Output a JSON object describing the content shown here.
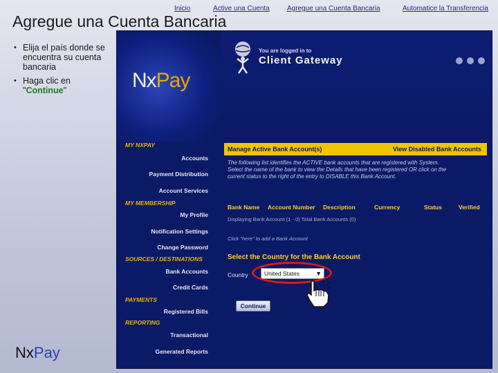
{
  "topnav": {
    "items": [
      {
        "label": "Inicio"
      },
      {
        "label": "Active una Cuenta"
      },
      {
        "label": "Agregue una Cuenta Bancaria"
      },
      {
        "label": "Automatice la Transferencia"
      }
    ]
  },
  "slide": {
    "title": "Agregue una Cuenta Bancaria",
    "bullets": [
      {
        "text": "Elija el país donde se encuentra su cuenta bancaria"
      },
      {
        "text_before": "Haga clic en \"",
        "highlight": "Continue",
        "text_after": "\""
      }
    ],
    "footer_brand": {
      "nx": "Nx",
      "pay": "Pay"
    }
  },
  "app": {
    "logo": {
      "nx": "Nx",
      "pay": "Pay"
    },
    "header": {
      "logged_in": "You are logged in to",
      "gateway": "Client Gateway"
    },
    "leftnav": [
      {
        "type": "section",
        "label": "MY NXPAY"
      },
      {
        "type": "item",
        "label": "Accounts"
      },
      {
        "type": "item",
        "label": "Payment Distribution"
      },
      {
        "type": "item",
        "label": "Account Services"
      },
      {
        "type": "section",
        "label": "MY MEMBERSHIP"
      },
      {
        "type": "item",
        "label": "My Profile"
      },
      {
        "type": "item",
        "label": "Notification Settings"
      },
      {
        "type": "item",
        "label": "Change Password"
      },
      {
        "type": "section",
        "label": "SOURCES / DESTINATIONS"
      },
      {
        "type": "item",
        "label": "Bank Accounts"
      },
      {
        "type": "item",
        "label": "Credit Cards"
      },
      {
        "type": "section",
        "label": "PAYMENTS"
      },
      {
        "type": "item",
        "label": "Registered Bills"
      },
      {
        "type": "section",
        "label": "REPORTING"
      },
      {
        "type": "item",
        "label": "Transactional"
      },
      {
        "type": "item",
        "label": "Generated Reports"
      }
    ],
    "main": {
      "bar_title": "Manage Active Bank Account(s)",
      "bar_link": "View Disabled Bank Accounts",
      "description": "The following list identifies the ACTIVE bank accounts that are registered with System. Select the name of the bank to view the Details that have been registered OR click on the current status to the right of the entry to DISABLE this Bank Account.",
      "columns": [
        "Bank Name",
        "Account Number",
        "Description",
        "Currency",
        "Status",
        "Verified"
      ],
      "displaying": "Displaying Bank Account (1 - 0)   Total Bank Accounts (0)",
      "click_here": "Click \"here\" to add a Bank Account",
      "select_title": "Select the Country for the Bank Account",
      "country_label": "Country",
      "country_value": "United States",
      "continue_label": "Continue"
    }
  }
}
